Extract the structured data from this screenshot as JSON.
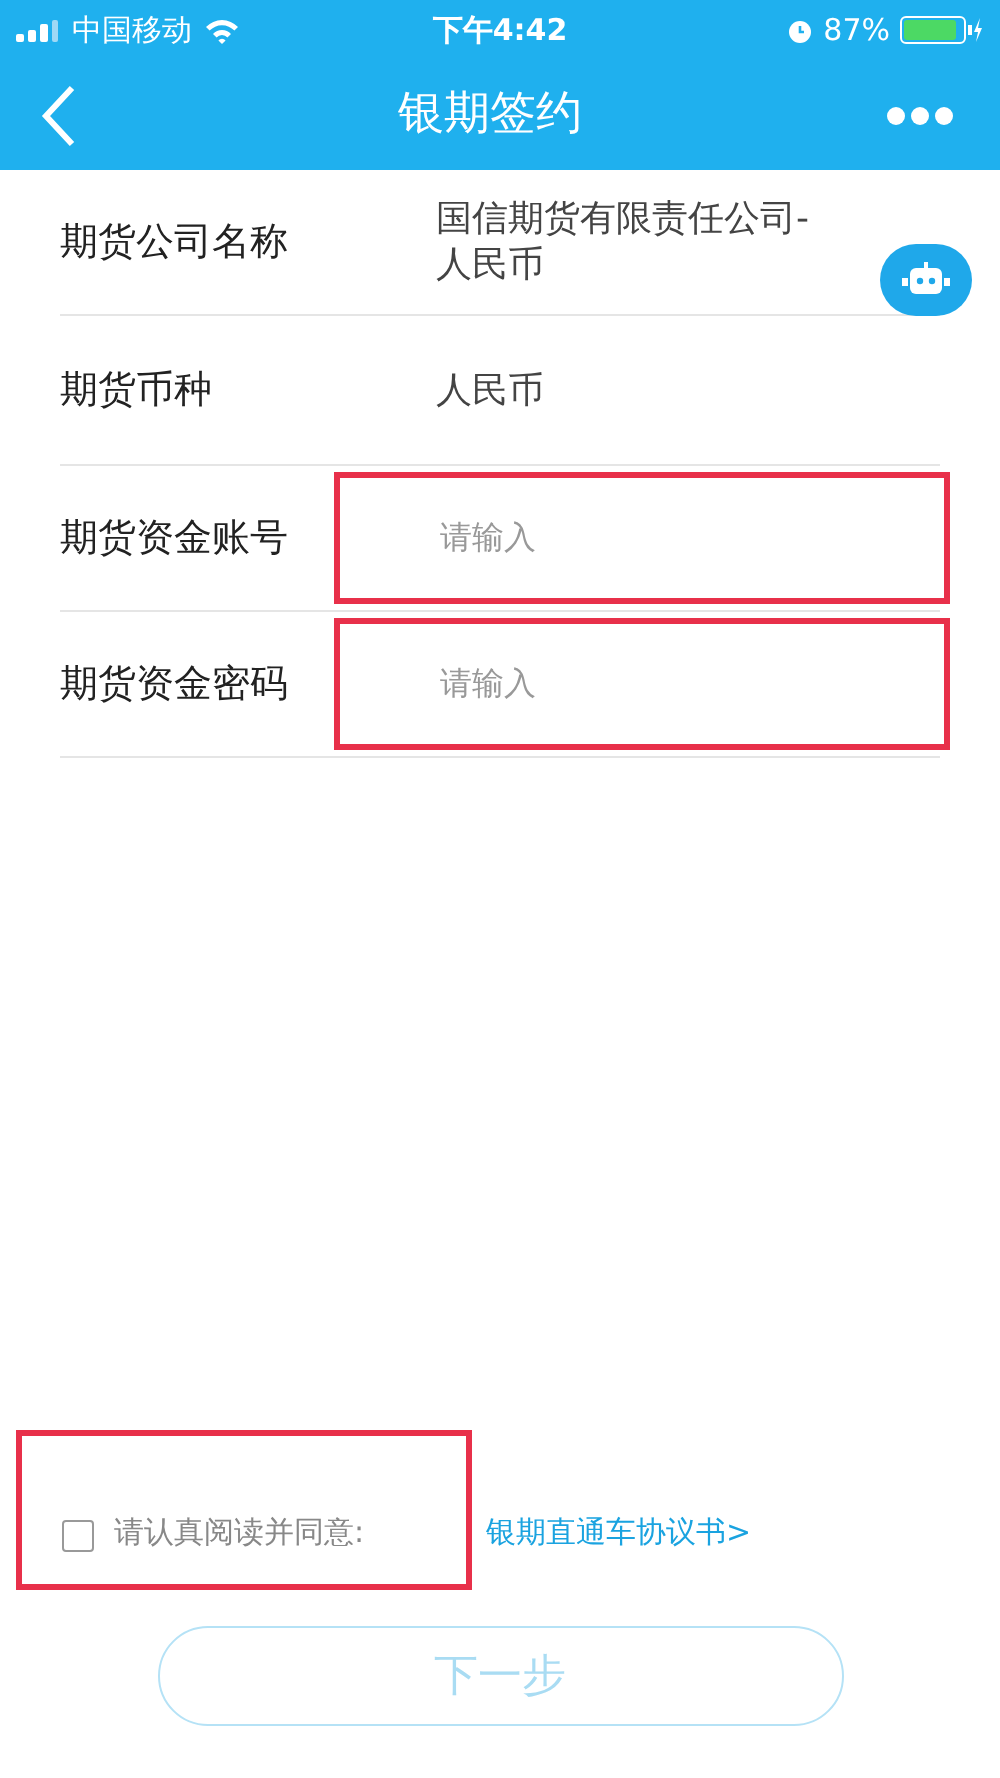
{
  "status_bar": {
    "carrier": "中国移动",
    "time": "下午4:42",
    "battery": "87%"
  },
  "nav": {
    "title": "银期签约"
  },
  "rows": [
    {
      "kind": "text",
      "label": "期货公司名称",
      "value": "国信期货有限责任公司-人民币"
    },
    {
      "kind": "text",
      "label": "期货币种",
      "value": "人民币"
    },
    {
      "kind": "input",
      "label": "期货资金账号",
      "placeholder": "请输入",
      "highlighted": true
    },
    {
      "kind": "input",
      "label": "期货资金密码",
      "placeholder": "请输入",
      "highlighted": true
    }
  ],
  "agreement": {
    "checked": false,
    "highlighted": true,
    "text": "请认真阅读并同意:",
    "link": "银期直通车协议书>"
  },
  "next_button": {
    "label": "下一步",
    "disabled": true
  }
}
